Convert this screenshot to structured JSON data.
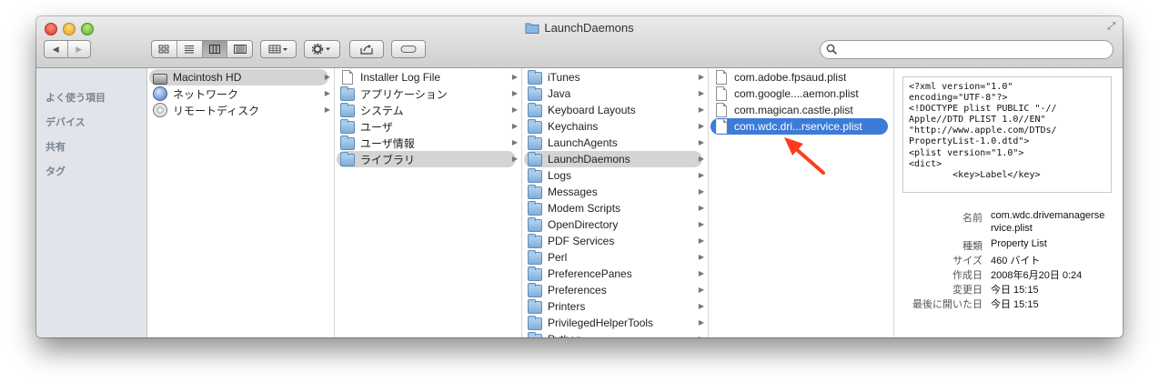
{
  "window": {
    "title": "LaunchDaemons"
  },
  "toolbar": {
    "back": "◀",
    "forward": "▶",
    "view_icon": "icon-view-icon",
    "view_list": "list-view-icon",
    "view_column": "column-view-icon",
    "view_coverflow": "coverflow-view-icon"
  },
  "sidebar": {
    "sections": [
      "よく使う項目",
      "デバイス",
      "共有",
      "タグ"
    ]
  },
  "col1": [
    {
      "label": "Macintosh HD",
      "icon": "disk-icon",
      "state": "highlight"
    },
    {
      "label": "ネットワーク",
      "icon": "globe-icon",
      "state": ""
    },
    {
      "label": "リモートディスク",
      "icon": "cd-icon",
      "state": ""
    }
  ],
  "col2": [
    {
      "label": "Installer Log File",
      "icon": "document-icon",
      "state": ""
    },
    {
      "label": "アプリケーション",
      "icon": "folder-icon",
      "state": ""
    },
    {
      "label": "システム",
      "icon": "folder-icon",
      "state": ""
    },
    {
      "label": "ユーザ",
      "icon": "folder-icon",
      "state": ""
    },
    {
      "label": "ユーザ情報",
      "icon": "folder-icon",
      "state": ""
    },
    {
      "label": "ライブラリ",
      "icon": "folder-icon",
      "state": "highlight"
    }
  ],
  "col3": [
    {
      "label": "iTunes",
      "state": ""
    },
    {
      "label": "Java",
      "state": ""
    },
    {
      "label": "Keyboard Layouts",
      "state": ""
    },
    {
      "label": "Keychains",
      "state": ""
    },
    {
      "label": "LaunchAgents",
      "state": ""
    },
    {
      "label": "LaunchDaemons",
      "state": "highlight"
    },
    {
      "label": "Logs",
      "state": ""
    },
    {
      "label": "Messages",
      "state": ""
    },
    {
      "label": "Modem Scripts",
      "state": ""
    },
    {
      "label": "OpenDirectory",
      "state": ""
    },
    {
      "label": "PDF Services",
      "state": ""
    },
    {
      "label": "Perl",
      "state": ""
    },
    {
      "label": "PreferencePanes",
      "state": ""
    },
    {
      "label": "Preferences",
      "state": ""
    },
    {
      "label": "Printers",
      "state": ""
    },
    {
      "label": "PrivilegedHelperTools",
      "state": ""
    },
    {
      "label": "Python",
      "state": ""
    }
  ],
  "col4": [
    {
      "label": "com.adobe.fpsaud.plist",
      "state": ""
    },
    {
      "label": "com.google....aemon.plist",
      "state": ""
    },
    {
      "label": "com.magican.castle.plist",
      "state": ""
    },
    {
      "label": "com.wdc.dri...rservice.plist",
      "state": "selected"
    }
  ],
  "preview": {
    "text": "<?xml version=\"1.0\"\nencoding=\"UTF-8\"?>\n<!DOCTYPE plist PUBLIC \"-//\nApple//DTD PLIST 1.0//EN\"\n\"http://www.apple.com/DTDs/\nPropertyList-1.0.dtd\">\n<plist version=\"1.0\">\n<dict>\n        <key>Label</key>"
  },
  "info": {
    "name_label": "名前",
    "name_value_1": "com.wdc.drivemanagerse",
    "name_value_2": "rvice.plist",
    "kind_label": "種類",
    "kind_value": "Property List",
    "size_label": "サイズ",
    "size_value": "460 バイト",
    "created_label": "作成日",
    "created_value": "2008年6月20日 0:24",
    "modified_label": "変更日",
    "modified_value": "今日 15:15",
    "opened_label": "最後に開いた日",
    "opened_value": "今日 15:15"
  },
  "colors": {
    "selection": "#3d7bd9",
    "highlight": "#d4d4d4",
    "sidebar": "#e1e5eb",
    "annotation_arrow": "#ff3b1f"
  }
}
